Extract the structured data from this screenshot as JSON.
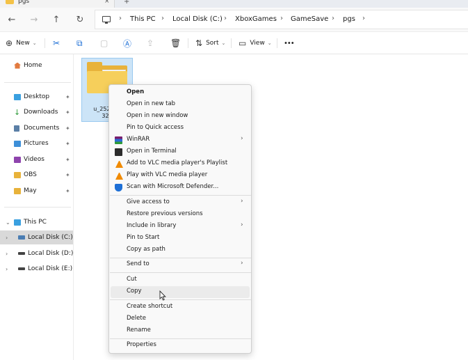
{
  "window": {
    "tab_title": "pgs",
    "tab_close": "×",
    "new_tab": "+"
  },
  "nav": {
    "back": "←",
    "forward": "→",
    "up": "↑",
    "refresh": "↻"
  },
  "breadcrumb": {
    "chevron": "›",
    "items": [
      "This PC",
      "Local Disk (C:)",
      "XboxGames",
      "GameSave",
      "pgs"
    ]
  },
  "toolbar": {
    "new_label": "New",
    "sort_label": "Sort",
    "view_label": "View",
    "more_label": "•••",
    "dropdown": "⌄"
  },
  "sidebar": {
    "home": "Home",
    "quick": [
      {
        "label": "Desktop",
        "color": "#3aa0e0"
      },
      {
        "label": "Downloads",
        "color": "#2e9b3a"
      },
      {
        "label": "Documents",
        "color": "#5b7fa6"
      },
      {
        "label": "Pictures",
        "color": "#3d8fd8"
      },
      {
        "label": "Videos",
        "color": "#8e44ad"
      },
      {
        "label": "OBS",
        "color": "#e8b23a"
      },
      {
        "label": "May",
        "color": "#e8b23a"
      }
    ],
    "pin": "📌",
    "this_pc": "This PC",
    "drives": [
      "Local Disk (C:)",
      "Local Disk (D:)",
      "Local Disk (E:)"
    ],
    "collapse": "⌄",
    "expand": "›"
  },
  "content": {
    "folder_label_line1": "u_252312",
    "folder_label_line2": "321"
  },
  "context_menu": {
    "group1": [
      {
        "label": "Open",
        "bold": true
      },
      {
        "label": "Open in new tab"
      },
      {
        "label": "Open in new window"
      },
      {
        "label": "Pin to Quick access"
      },
      {
        "label": "WinRAR",
        "icon": "winrar-icon",
        "submenu": true
      },
      {
        "label": "Open in Terminal",
        "icon": "terminal-icon"
      },
      {
        "label": "Add to VLC media player's Playlist",
        "icon": "vlc-icon"
      },
      {
        "label": "Play with VLC media player",
        "icon": "vlc-icon"
      },
      {
        "label": "Scan with Microsoft Defender...",
        "icon": "defender-icon"
      }
    ],
    "group2": [
      {
        "label": "Give access to",
        "submenu": true
      },
      {
        "label": "Restore previous versions"
      },
      {
        "label": "Include in library",
        "submenu": true
      },
      {
        "label": "Pin to Start"
      },
      {
        "label": "Copy as path"
      }
    ],
    "group3": [
      {
        "label": "Send to",
        "submenu": true
      }
    ],
    "group4": [
      {
        "label": "Cut"
      },
      {
        "label": "Copy",
        "hover": true
      }
    ],
    "group5": [
      {
        "label": "Create shortcut"
      },
      {
        "label": "Delete"
      },
      {
        "label": "Rename"
      }
    ],
    "group6": [
      {
        "label": "Properties"
      }
    ],
    "submenu_arrow": "›"
  }
}
